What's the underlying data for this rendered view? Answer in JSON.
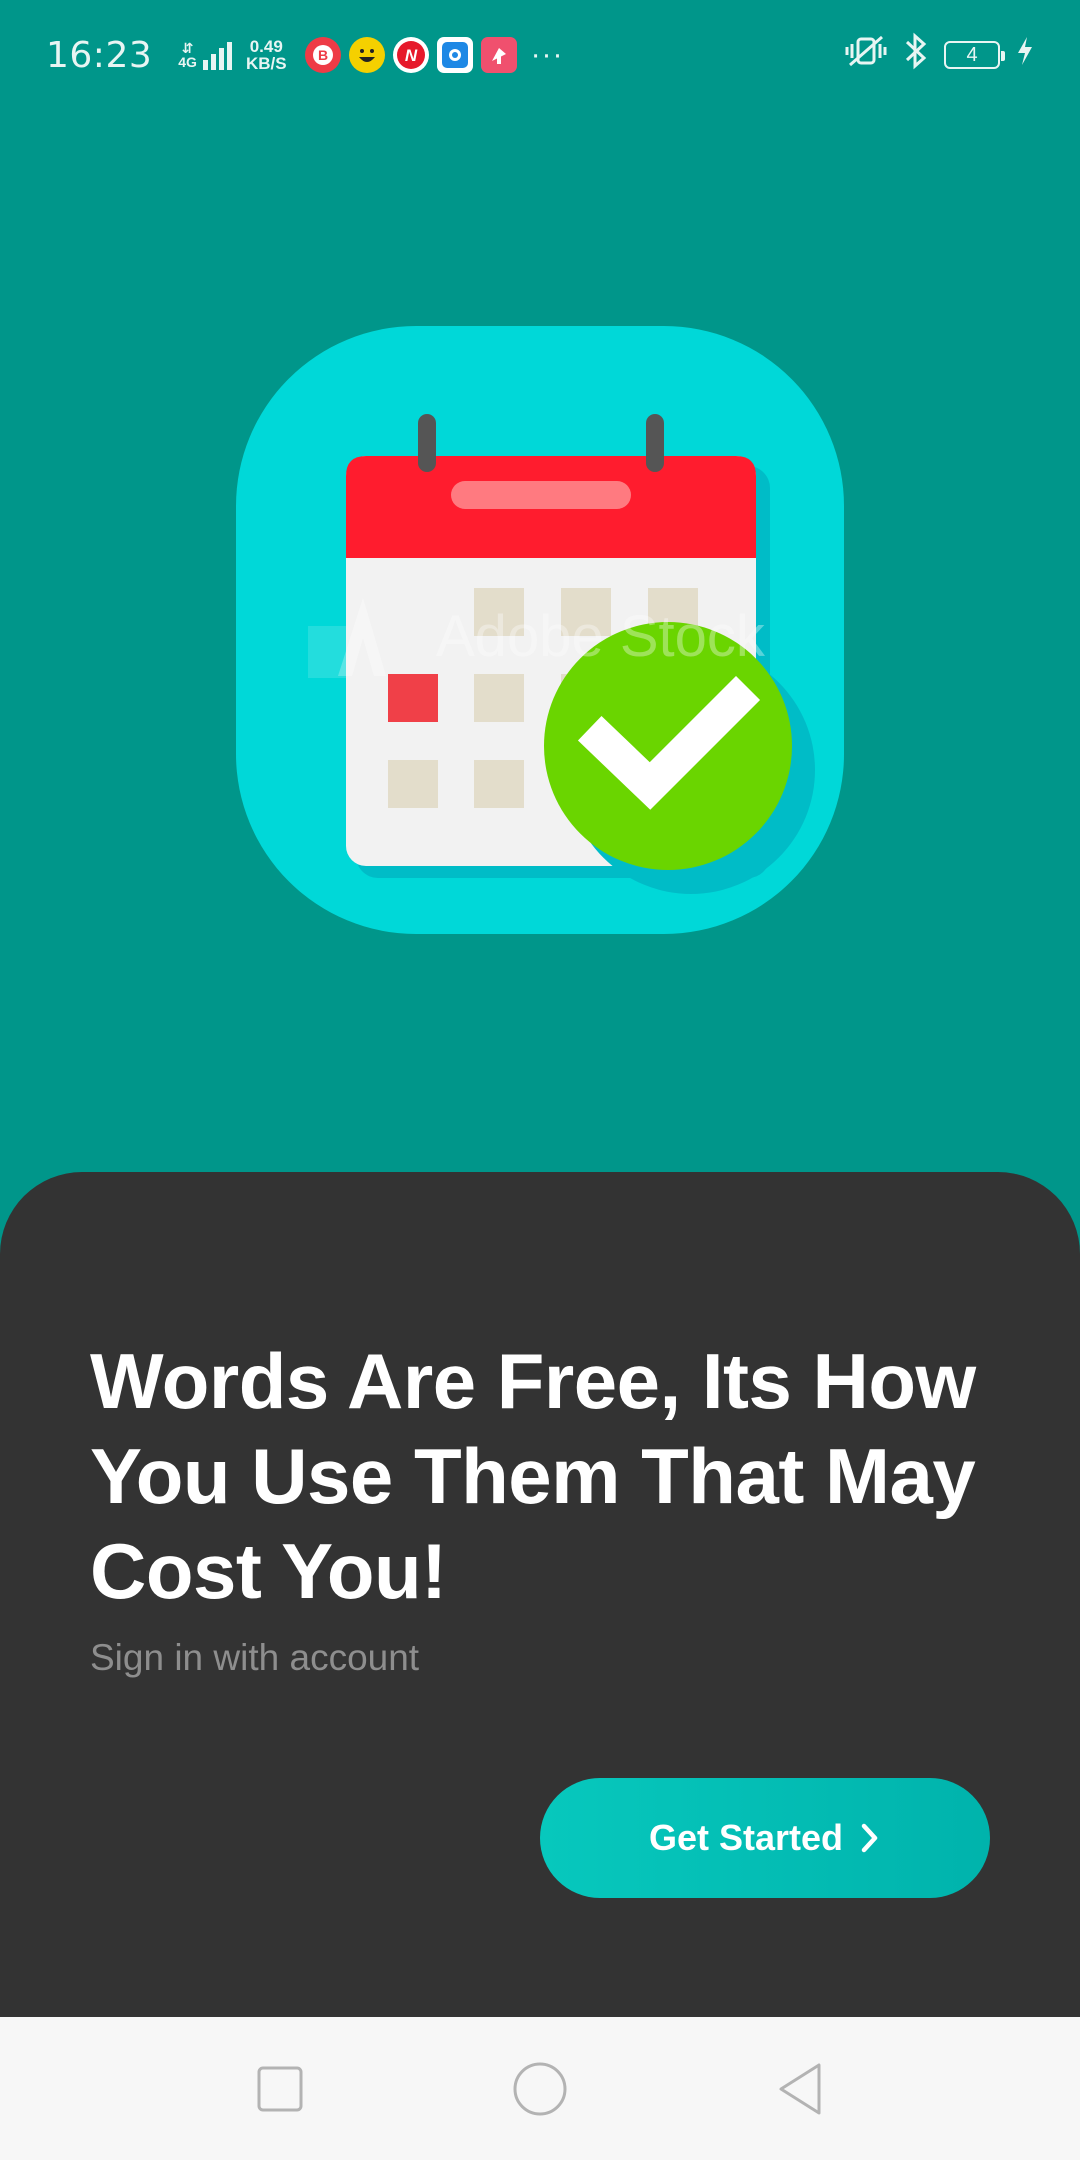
{
  "status_bar": {
    "time": "16:23",
    "network_type": "4G",
    "speed_value": "0.49",
    "speed_unit": "KB/S",
    "battery_level": "4",
    "notification_icons": [
      "app-b-icon",
      "emoji-icon",
      "news-n-icon",
      "blue-app-icon",
      "pink-app-icon"
    ]
  },
  "illustration": {
    "icon": "calendar-check-icon",
    "watermark": "Adobe Stock"
  },
  "onboarding": {
    "headline": "Words Are Free, Its How You Use Them That May Cost You!",
    "subtext": "Sign in with account",
    "cta_label": "Get Started"
  },
  "colors": {
    "background": "#00968A",
    "sheet": "#333333",
    "accent": "#07C8BD",
    "calendar_red": "#FF1C2E",
    "check_green": "#6AD500",
    "tile_cyan": "#00D8D8"
  },
  "nav_bar": {
    "buttons": [
      "recent-apps-icon",
      "home-icon",
      "back-icon"
    ]
  }
}
